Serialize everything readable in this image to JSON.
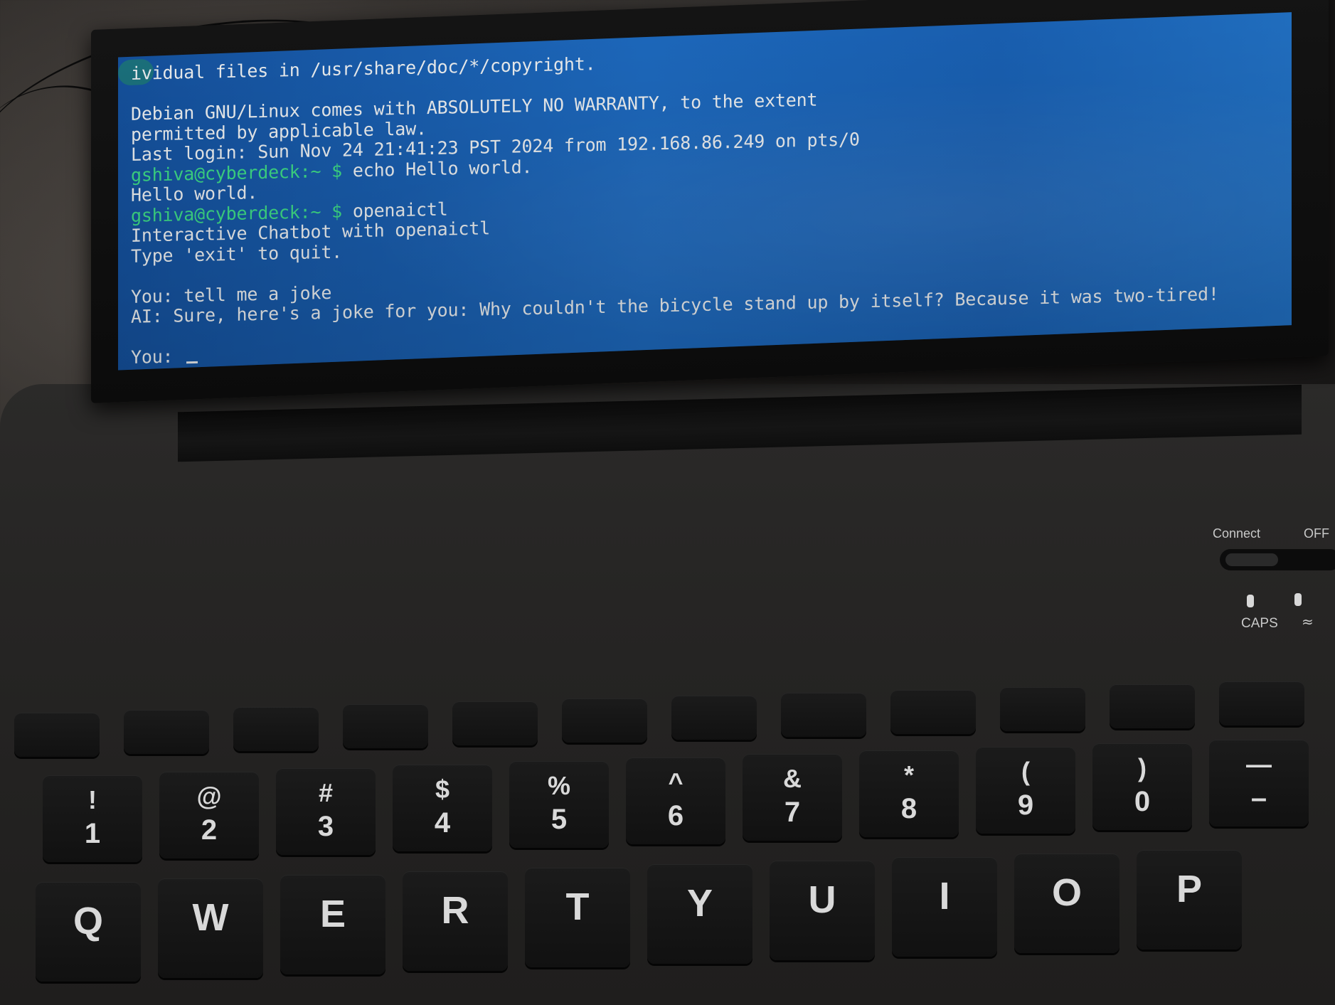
{
  "terminal": {
    "lines": [
      {
        "text": "ividual files in /usr/share/doc/*/copyright."
      },
      {
        "text": ""
      },
      {
        "text": "Debian GNU/Linux comes with ABSOLUTELY NO WARRANTY, to the extent"
      },
      {
        "text": "permitted by applicable law."
      },
      {
        "text": "Last login: Sun Nov 24 21:41:23 PST 2024 from 192.168.86.249 on pts/0"
      },
      {
        "prompt": "gshiva@cyberdeck:~ $",
        "text": " echo Hello world."
      },
      {
        "text": "Hello world."
      },
      {
        "prompt": "gshiva@cyberdeck:~ $",
        "text": " openaictl"
      },
      {
        "text": "Interactive Chatbot with openaictl"
      },
      {
        "text": "Type 'exit' to quit."
      },
      {
        "text": ""
      },
      {
        "text": "You: tell me a joke"
      },
      {
        "text": "AI: Sure, here's a joke for you: Why couldn't the bicycle stand up by itself? Because it was two-tired!"
      },
      {
        "text": ""
      },
      {
        "text": "You: "
      }
    ],
    "colors": {
      "background": "#1e6cc3",
      "text": "#f2f5f7",
      "prompt": "#3fe08a"
    }
  },
  "keyboard": {
    "status": {
      "connect_label": "Connect",
      "off_label": "OFF",
      "caps_label": "CAPS",
      "wireless_icon": "wifi-icon"
    },
    "number_row": [
      {
        "top": "!",
        "bottom": "1"
      },
      {
        "top": "@",
        "bottom": "2"
      },
      {
        "top": "#",
        "bottom": "3"
      },
      {
        "top": "$",
        "bottom": "4"
      },
      {
        "top": "%",
        "bottom": "5"
      },
      {
        "top": "^",
        "bottom": "6"
      },
      {
        "top": "&",
        "bottom": "7"
      },
      {
        "top": "*",
        "bottom": "8"
      },
      {
        "top": "(",
        "bottom": "9"
      },
      {
        "top": ")",
        "bottom": "0"
      },
      {
        "top": "—",
        "bottom": "–"
      }
    ],
    "letter_row": [
      "Q",
      "W",
      "E",
      "R",
      "T",
      "Y",
      "U",
      "I",
      "O",
      "P"
    ]
  }
}
